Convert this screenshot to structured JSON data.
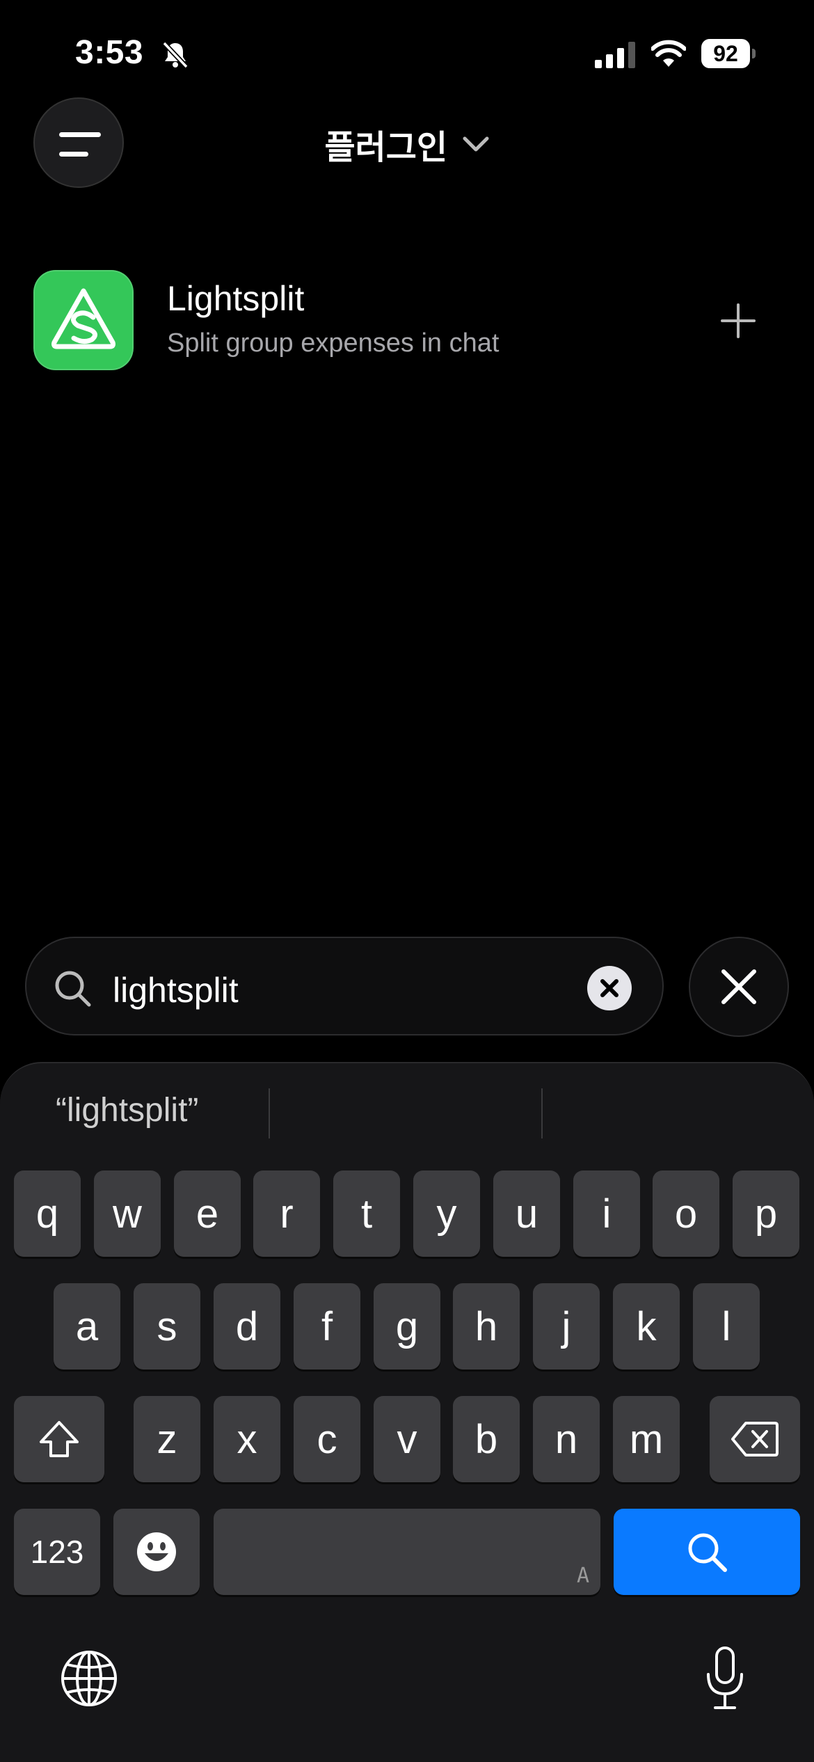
{
  "status_bar": {
    "time": "3:53",
    "battery": "92"
  },
  "header": {
    "title": "플러그인"
  },
  "plugins": [
    {
      "name": "Lightsplit",
      "description": "Split group expenses in chat"
    }
  ],
  "search": {
    "query": "lightsplit"
  },
  "keyboard": {
    "suggestion": "“lightsplit”",
    "row1": [
      "q",
      "w",
      "e",
      "r",
      "t",
      "y",
      "u",
      "i",
      "o",
      "p"
    ],
    "row2": [
      "a",
      "s",
      "d",
      "f",
      "g",
      "h",
      "j",
      "k",
      "l"
    ],
    "row3": [
      "z",
      "x",
      "c",
      "v",
      "b",
      "n",
      "m"
    ],
    "numbers_key": "123",
    "space_mark": "A"
  },
  "colors": {
    "accent": "#0a7aff",
    "app_icon": "#34c759"
  }
}
